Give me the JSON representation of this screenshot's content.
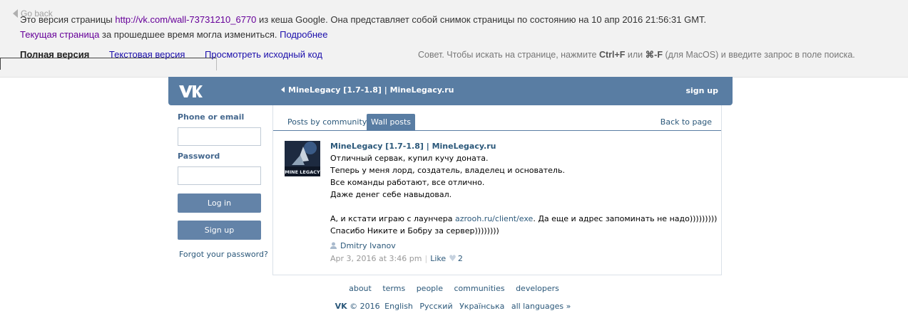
{
  "google_cache": {
    "go_back": "Go back",
    "line1_prefix": "Это версия страницы ",
    "url": "http://vk.com/wall-73731210_6770",
    "line1_suffix": " из кеша Google. Она представляет собой снимок страницы по состоянию на 10 апр 2016 21:56:31 GMT.",
    "current_page_link": "Текущая страница",
    "line2_middle": " за прошедшее время могла измениться. ",
    "more_link": "Подробнее",
    "tab_full": "Полная версия",
    "tab_text": "Текстовая версия",
    "tab_source": "Просмотреть исходный код",
    "tip_prefix": "Совет. Чтобы искать на странице, нажмите ",
    "tip_ctrl": "Ctrl+F",
    "tip_or": " или ",
    "tip_cmd": "⌘-F",
    "tip_suffix": " (для MacOS) и введите запрос в поле поиска."
  },
  "header": {
    "title": "MineLegacy [1.7-1.8] | MineLegacy.ru",
    "signup": "sign up"
  },
  "login": {
    "phone_label": "Phone or email",
    "phone_value": "",
    "password_label": "Password",
    "password_value": "",
    "login_button": "Log in",
    "signup_button": "Sign up",
    "forgot": "Forgot your password?"
  },
  "tabs": {
    "community": "Posts by community",
    "wall": "Wall posts",
    "back": "Back to page"
  },
  "post": {
    "author": "MineLegacy [1.7-1.8] | MineLegacy.ru",
    "line1": "Отличный сервак, купил кучу доната.",
    "line2": "Теперь у меня лорд, создатель, владелец и основатель.",
    "line3": "Все команды работают, все отлично.",
    "line4": "Даже денег себе навыдовал.",
    "line5_prefix": "А, и кстати играю с лаунчера ",
    "line5_link": "azrooh.ru/client/exe",
    "line5_suffix": ". Да еще и адрес запоминать не надо)))))))))",
    "line6": "Спасибо Никите и Бобру за сервер))))))))",
    "signer": "Dmitry Ivanov",
    "date": "Apr 3, 2016 at 3:46 pm",
    "like": "Like",
    "likes": "2",
    "avatar_text": "MINE LEGACY"
  },
  "footer": {
    "links": [
      "about",
      "terms",
      "people",
      "communities",
      "developers"
    ],
    "vk": "VK",
    "copyright": "© 2016",
    "languages": [
      "English",
      "Русский",
      "Українська",
      "all languages »"
    ]
  },
  "colors": {
    "vk_blue": "#597da3",
    "button_blue": "#6383a8",
    "link_blue": "#2b587a"
  }
}
